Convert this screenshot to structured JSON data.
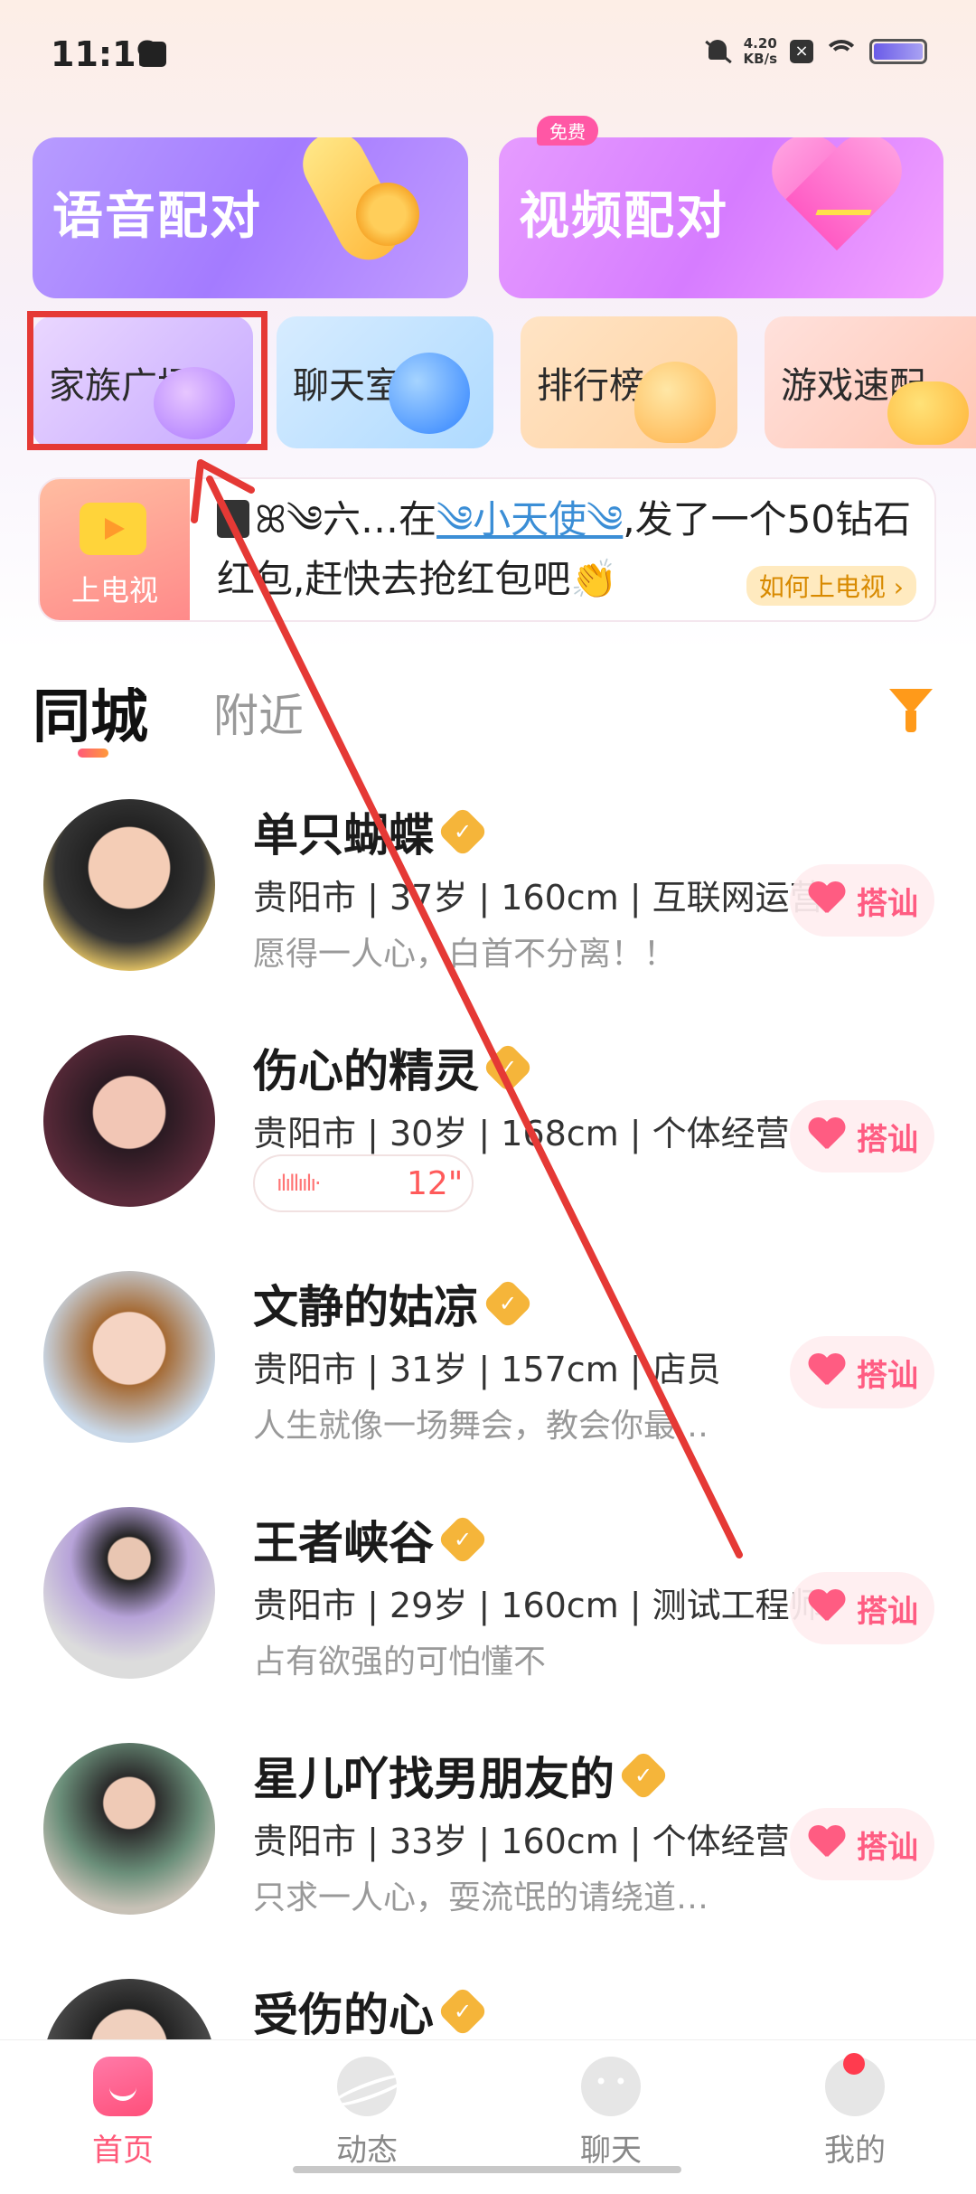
{
  "status_bar": {
    "time": "11:19",
    "net_speed_value": "4.20",
    "net_speed_unit": "KB/s",
    "icons": [
      "message-icon",
      "mute-bell-icon",
      "close-box-icon",
      "wifi-icon",
      "battery-icon"
    ]
  },
  "match_cards": {
    "voice": {
      "label": "语音配对"
    },
    "video": {
      "label": "视频配对",
      "badge": "免费"
    }
  },
  "tiles": [
    {
      "label": "家族广场"
    },
    {
      "label": "聊天室"
    },
    {
      "label": "排行榜"
    },
    {
      "label": "游戏速配"
    }
  ],
  "tv_banner": {
    "label": "上电视",
    "message_prefix": "ꕤ༄六…在",
    "highlight_user": "༄小天使༄",
    "message_mid": ",发了一个50钻石红包,赶快去抢红包吧",
    "emoji": "👏",
    "how_button": "如何上电视 ›"
  },
  "tabs": {
    "active": "同城",
    "inactive": "附近"
  },
  "users": [
    {
      "name": "单只蝴蝶",
      "info": "贵阳市 | 37岁 | 160cm | 互联网运营",
      "bio": "愿得一人心，白首不分离！！"
    },
    {
      "name": "伤心的精灵",
      "info": "贵阳市 | 30岁 | 168cm | 个体经营",
      "voice_duration": "12\""
    },
    {
      "name": "文静的姑凉",
      "info": "贵阳市 | 31岁 | 157cm | 店员",
      "bio": "人生就像一场舞会，教会你最…"
    },
    {
      "name": "王者峡谷",
      "info": "贵阳市 | 29岁 | 160cm | 测试工程师",
      "bio": "占有欲强的可怕懂不"
    },
    {
      "name": "星儿吖找男朋友的",
      "info": "贵阳市 | 33岁 | 160cm | 个体经营",
      "bio": "只求一人心，耍流氓的请绕道…"
    },
    {
      "name": "受伤的心"
    }
  ],
  "greet_label": "搭讪",
  "bottom_nav": [
    {
      "label": "首页",
      "active": true
    },
    {
      "label": "动态"
    },
    {
      "label": "聊天"
    },
    {
      "label": "我的",
      "badge_dot": true
    }
  ],
  "colors": {
    "accent": "#ff5a7a",
    "highlight_box": "#e53935",
    "verified": "#f5b53a",
    "filter": "#ff9a1a"
  }
}
